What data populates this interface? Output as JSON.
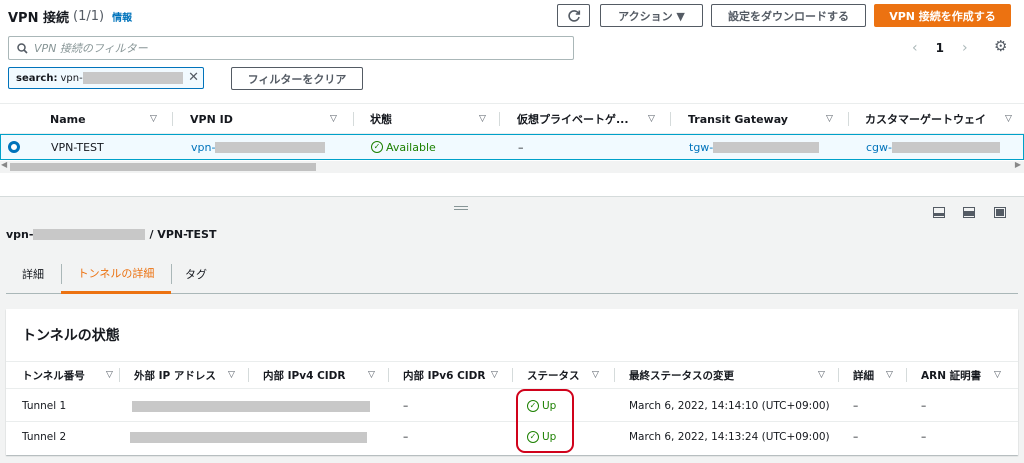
{
  "header": {
    "title": "VPN 接続",
    "count": "(1/1)",
    "info": "情報"
  },
  "toolbar": {
    "refresh_icon": "refresh-icon",
    "actions": "アクション ▼",
    "download": "設定をダウンロードする",
    "create": "VPN 接続を作成する"
  },
  "filter": {
    "placeholder": "VPN 接続のフィルター",
    "token_key": "search:",
    "token_value": "vpn-",
    "clear": "フィルターをクリア"
  },
  "pagination": {
    "page": "1"
  },
  "table": {
    "columns": [
      "Name",
      "VPN ID",
      "状態",
      "仮想プライベートゲ...",
      "Transit Gateway",
      "カスタマーゲートウェイ"
    ],
    "rows": [
      {
        "name": "VPN-TEST",
        "vpn_id": "vpn-",
        "state": "Available",
        "vgw": "–",
        "tgw": "tgw-",
        "cgw": "cgw-"
      }
    ]
  },
  "detail": {
    "id_prefix": "vpn-",
    "name_suffix": "/ VPN-TEST",
    "tabs": [
      "詳細",
      "トンネルの詳細",
      "タグ"
    ],
    "active_tab": 1
  },
  "tunnels": {
    "title": "トンネルの状態",
    "columns": [
      "トンネル番号",
      "外部 IP アドレス",
      "内部 IPv4 CIDR",
      "内部 IPv6 CIDR",
      "ステータス",
      "最終ステータスの変更",
      "詳細",
      "ARN 証明書"
    ],
    "rows": [
      {
        "number": "Tunnel 1",
        "ipv6": "–",
        "status": "Up",
        "changed": "March 6, 2022, 14:14:10 (UTC+09:00)",
        "details": "–",
        "arn": "–"
      },
      {
        "number": "Tunnel 2",
        "ipv6": "–",
        "status": "Up",
        "changed": "March 6, 2022, 14:13:24 (UTC+09:00)",
        "details": "–",
        "arn": "–"
      }
    ]
  },
  "colors": {
    "accent": "#ec7211",
    "link": "#0073bb",
    "success": "#1d8102",
    "highlight": "#d0021b"
  }
}
